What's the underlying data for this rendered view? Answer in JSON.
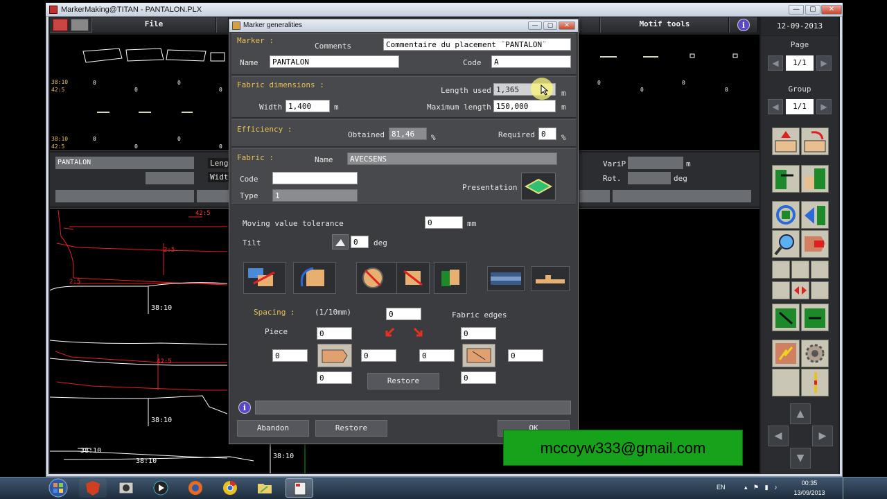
{
  "window": {
    "title": "MarkerMaking@TITAN - PANTALON.PLX",
    "min": "—",
    "max": "▢",
    "close": "✕"
  },
  "menu": {
    "file_label": "File",
    "motif_tools_label": "Motif tools",
    "date": "12-09-2013"
  },
  "right_panel": {
    "page_label": "Page",
    "page_value": "1/1",
    "group_label": "Group",
    "group_value": "1/1"
  },
  "workspace": {
    "marker_name_field": "PANTALON",
    "length_label_partial": "Leng",
    "width_label_partial": "Widt",
    "varip_label": "VariP",
    "rot_label": "Rot.",
    "unit_m": "m",
    "unit_deg": "deg",
    "band1_left_labels": [
      "38:10",
      "42:5"
    ],
    "band2_left_labels": [
      "38:10",
      "42:5"
    ],
    "zero": "0",
    "canvas_labels": {
      "size_38_10": "38:10",
      "size_42_5": "42:5",
      "size_2_5": "2:5"
    }
  },
  "dialog": {
    "title": "Marker generalities",
    "marker_section": "Marker :",
    "comments_label": "Comments",
    "comments_value": "Commentaire du placement ¨PANTALON¨",
    "name_label": "Name",
    "name_value": "PANTALON",
    "code_label": "Code",
    "code_value": "A",
    "fabric_dims_section": "Fabric dimensions :",
    "length_used_label": "Length used",
    "length_used_value": "1,365",
    "width_label": "Width",
    "width_value": "1,400",
    "max_length_label": "Maximum length",
    "max_length_value": "150,000",
    "unit_m": "m",
    "efficiency_section": "Efficiency :",
    "obtained_label": "Obtained",
    "obtained_value": "81,46",
    "required_label": "Required",
    "required_value": "0",
    "unit_pct": "%",
    "fabric_section": "Fabric :",
    "fabric_name_label": "Name",
    "fabric_name_value": "AVECSENS",
    "fabric_code_label": "Code",
    "fabric_code_value": "",
    "type_label": "Type",
    "type_value": "1",
    "presentation_label": "Presentation",
    "moving_tol_label": "Moving value tolerance",
    "moving_tol_value": "0",
    "unit_mm": "mm",
    "tilt_label": "Tilt",
    "tilt_value": "0",
    "unit_deg": "deg",
    "spacing_label": "Spacing :",
    "spacing_units": "(1/10mm)",
    "spacing_value": "0",
    "fabric_edges_label": "Fabric edges",
    "piece_label": "Piece",
    "piece_top": "0",
    "piece_left": "0",
    "piece_right": "0",
    "piece_bottom": "0",
    "edge_top": "0",
    "edge_left": "0",
    "edge_right": "0",
    "edge_bottom": "0",
    "restore_inner_label": "Restore",
    "abandon_label": "Abandon",
    "restore_label": "Restore",
    "ok_label": "OK"
  },
  "overlay": {
    "email": "mccoyw333@gmail.com"
  },
  "taskbar": {
    "lang": "EN",
    "time": "00:35",
    "date": "13/09/2013"
  }
}
